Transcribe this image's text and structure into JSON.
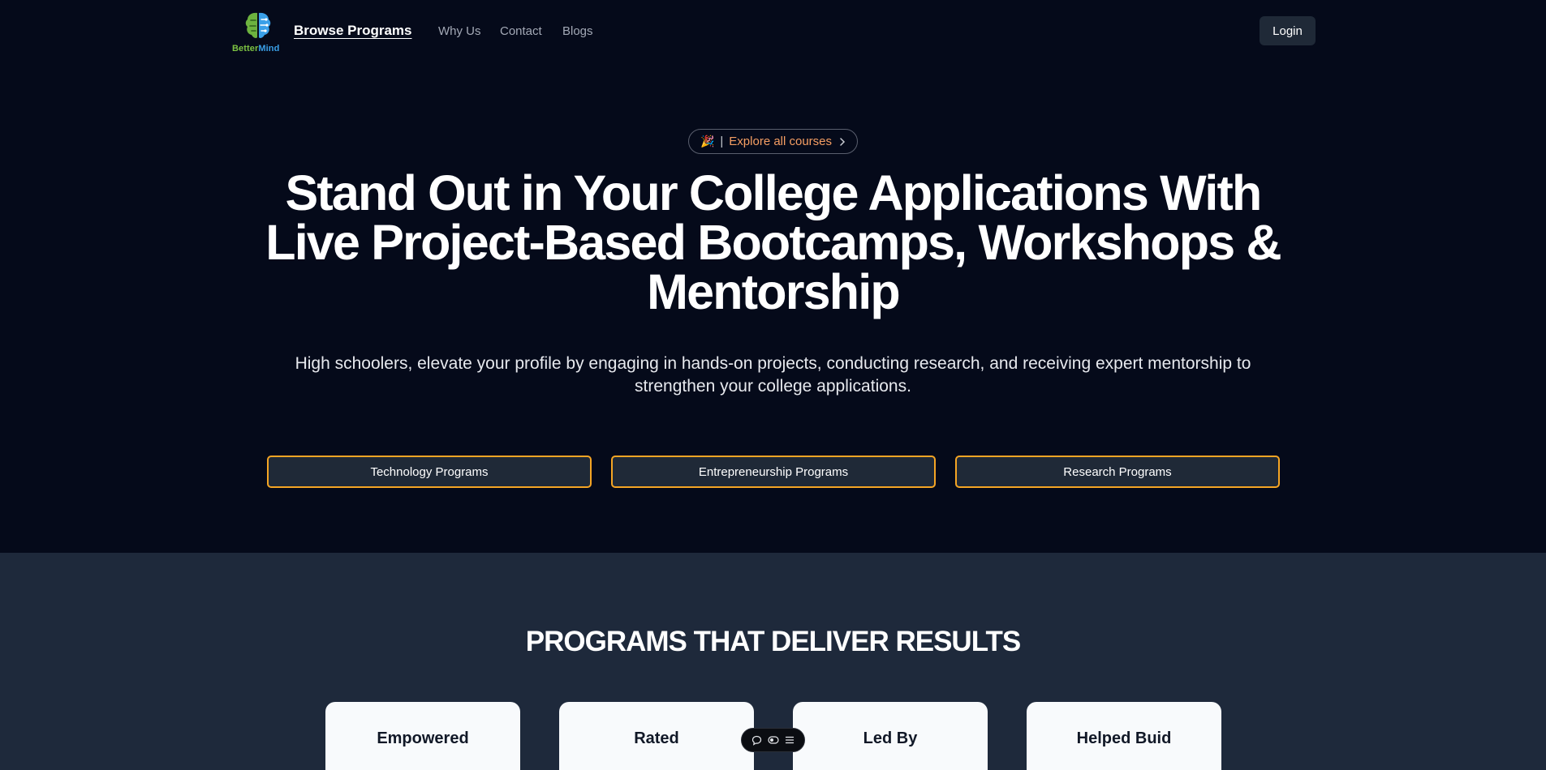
{
  "header": {
    "logo": {
      "text_part1": "Better",
      "text_part2": "Mind",
      "icon": "brain-logo-icon"
    },
    "nav_primary": "Browse Programs",
    "nav_links": [
      "Why Us",
      "Contact",
      "Blogs"
    ],
    "login_label": "Login"
  },
  "hero": {
    "pill": {
      "emoji": "🎉",
      "separator": "|",
      "label": "Explore all courses",
      "icon": "chevron-right-icon"
    },
    "title_line1": "Stand Out in Your College Applications With",
    "title_line2": "Live Project-Based Bootcamps, Workshops &",
    "title_line3": "Mentorship",
    "subtitle_line1": "High schoolers, elevate your profile by engaging in hands-on projects, conducting research, and receiving expert mentorship to",
    "subtitle_line2": "strengthen your college applications.",
    "program_buttons": [
      "Technology Programs",
      "Entrepreneurship Programs",
      "Research Programs"
    ]
  },
  "results": {
    "title": "PROGRAMS THAT DELIVER RESULTS",
    "cards": [
      "Empowered",
      "Rated",
      "Led By",
      "Helped Buid"
    ]
  },
  "floating_toolbar": {
    "icons": [
      "comment-icon",
      "toggle-icon",
      "menu-icon"
    ]
  },
  "colors": {
    "background": "#050a1a",
    "section_background": "#1e293b",
    "button_border": "#f5a524",
    "pill_text": "#f59e63",
    "logo_green": "#7cc242",
    "logo_blue": "#3aa0e8"
  }
}
